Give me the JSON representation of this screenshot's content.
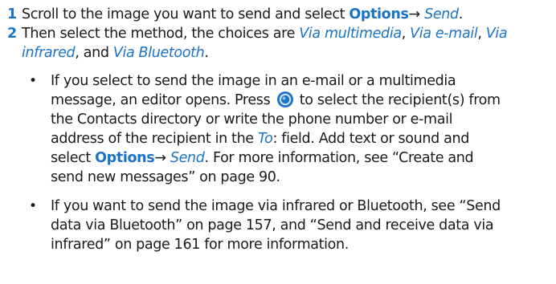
{
  "steps": [
    {
      "number": "1",
      "text_a": "Scroll to the image you want to send and select ",
      "options": "Options",
      "arrow": "→ ",
      "send": "Send",
      "end": "."
    },
    {
      "number": "2",
      "text_a": "Then select the method, the choices are ",
      "via_mms": "Via multimedia",
      "sep1": ", ",
      "via_email": "Via e-mail",
      "sep2": ", ",
      "via_ir_part1": "Via",
      "via_ir_part2": "infrared",
      "sep3": ", and ",
      "via_bt": "Via Bluetooth",
      "end": "."
    }
  ],
  "bullet_glyph": "•",
  "bullets": [
    {
      "line1": "If you select to send the image in an e-mail or a multimedia",
      "line2_a": "message, an editor opens. Press ",
      "nav_key_icon": "navigation-key-icon",
      "line2_b": " to select the recipient(s) from",
      "line3": "the Contacts directory or write the phone number or e-mail",
      "line4_a": "address of the recipient in the ",
      "to_field": "To",
      "line4_b": ": field. Add text or sound and",
      "line5_a": "select ",
      "options": "Options",
      "arrow": "→ ",
      "send": "Send",
      "line5_b": ". For more information, see “Create and",
      "line6": "send new messages” on page 90."
    },
    {
      "line1": "If you want to send the image via infrared or Bluetooth, see “Send",
      "line2": "data via Bluetooth” on page 157, and “Send and receive data via",
      "line3": "infrared” on page 161 for more information."
    }
  ],
  "colors": {
    "accent": "#1a73c7",
    "text": "#1a1a1a"
  }
}
